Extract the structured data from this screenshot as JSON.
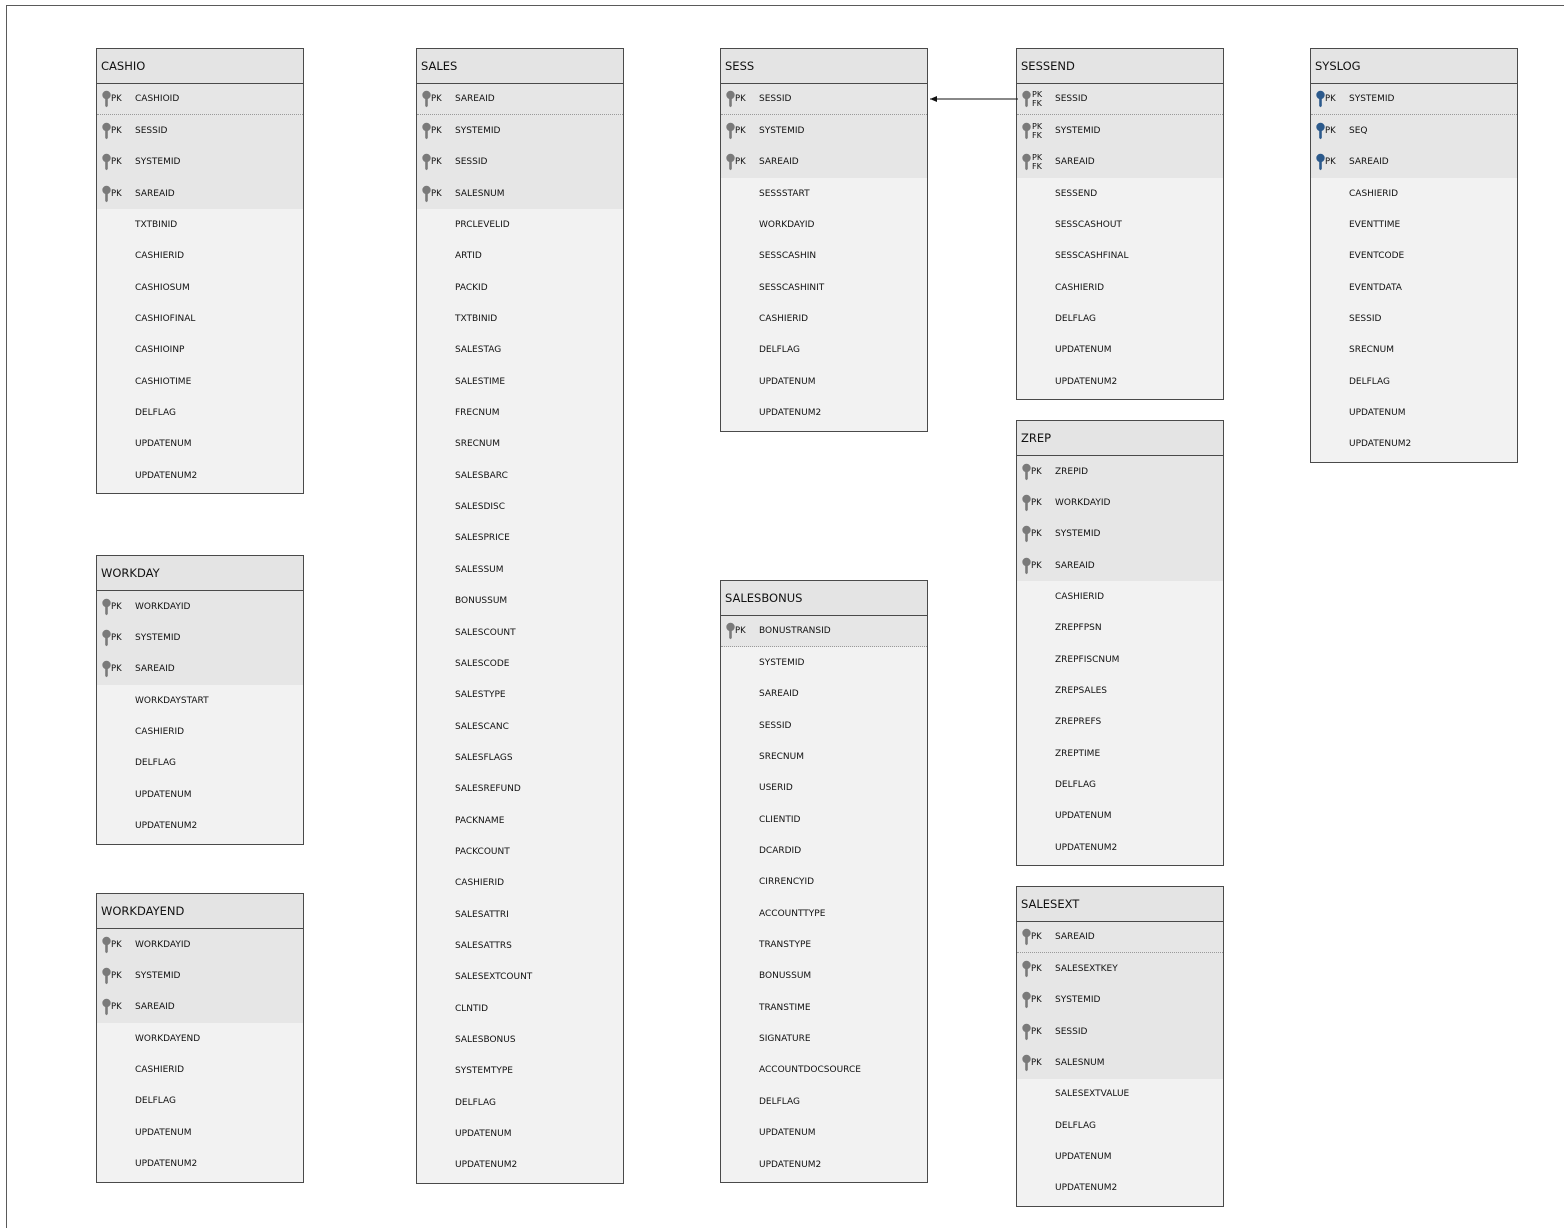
{
  "colors": {
    "key_grey": "#7a7a7a",
    "key_blue": "#2c5a8c",
    "header_bg": "#e4e4e4",
    "body_bg": "#f2f2f2"
  },
  "entities": {
    "cashio": {
      "name": "CASHIO",
      "keys": [
        {
          "label": "PK",
          "name": "CASHIOID"
        },
        {
          "label": "PK",
          "name": "SESSID"
        },
        {
          "label": "PK",
          "name": "SYSTEMID"
        },
        {
          "label": "PK",
          "name": "SAREAID"
        }
      ],
      "fields": [
        "TXTBINID",
        "CASHIERID",
        "CASHIOSUM",
        "CASHIOFINAL",
        "CASHIOINP",
        "CASHIOTIME",
        "DELFLAG",
        "UPDATENUM",
        "UPDATENUM2"
      ]
    },
    "workday": {
      "name": "WORKDAY",
      "keys": [
        {
          "label": "PK",
          "name": "WORKDAYID"
        },
        {
          "label": "PK",
          "name": "SYSTEMID"
        },
        {
          "label": "PK",
          "name": "SAREAID"
        }
      ],
      "fields": [
        "WORKDAYSTART",
        "CASHIERID",
        "DELFLAG",
        "UPDATENUM",
        "UPDATENUM2"
      ]
    },
    "workdayend": {
      "name": "WORKDAYEND",
      "keys": [
        {
          "label": "PK",
          "name": "WORKDAYID"
        },
        {
          "label": "PK",
          "name": "SYSTEMID"
        },
        {
          "label": "PK",
          "name": "SAREAID"
        }
      ],
      "fields": [
        "WORKDAYEND",
        "CASHIERID",
        "DELFLAG",
        "UPDATENUM",
        "UPDATENUM2"
      ]
    },
    "sales": {
      "name": "SALES",
      "keys": [
        {
          "label": "PK",
          "name": "SAREAID"
        },
        {
          "label": "PK",
          "name": "SYSTEMID"
        },
        {
          "label": "PK",
          "name": "SESSID"
        },
        {
          "label": "PK",
          "name": "SALESNUM"
        }
      ],
      "fields": [
        "PRCLEVELID",
        "ARTID",
        "PACKID",
        "TXTBINID",
        "SALESTAG",
        "SALESTIME",
        "FRECNUM",
        "SRECNUM",
        "SALESBARC",
        "SALESDISC",
        "SALESPRICE",
        "SALESSUM",
        "BONUSSUM",
        "SALESCOUNT",
        "SALESCODE",
        "SALESTYPE",
        "SALESCANC",
        "SALESFLAGS",
        "SALESREFUND",
        "PACKNAME",
        "PACKCOUNT",
        "CASHIERID",
        "SALESATTRI",
        "SALESATTRS",
        "SALESEXTCOUNT",
        "CLNTID",
        "SALESBONUS",
        "SYSTEMTYPE",
        "DELFLAG",
        "UPDATENUM",
        "UPDATENUM2"
      ]
    },
    "sess": {
      "name": "SESS",
      "keys": [
        {
          "label": "PK",
          "name": "SESSID"
        },
        {
          "label": "PK",
          "name": "SYSTEMID"
        },
        {
          "label": "PK",
          "name": "SAREAID"
        }
      ],
      "fields": [
        "SESSSTART",
        "WORKDAYID",
        "SESSCASHIN",
        "SESSCASHINIT",
        "CASHIERID",
        "DELFLAG",
        "UPDATENUM",
        "UPDATENUM2"
      ]
    },
    "salesbonus": {
      "name": "SALESBONUS",
      "keys": [
        {
          "label": "PK",
          "name": "BONUSTRANSID"
        }
      ],
      "fields": [
        "SYSTEMID",
        "SAREAID",
        "SESSID",
        "SRECNUM",
        "USERID",
        "CLIENTID",
        "DCARDID",
        "CIRRENCYID",
        "ACCOUNTTYPE",
        "TRANSTYPE",
        "BONUSSUM",
        "TRANSTIME",
        "SIGNATURE",
        "ACCOUNTDOCSOURCE",
        "DELFLAG",
        "UPDATENUM",
        "UPDATENUM2"
      ]
    },
    "sessend": {
      "name": "SESSEND",
      "keys": [
        {
          "label": "PK",
          "label2": "FK",
          "name": "SESSID"
        },
        {
          "label": "PK",
          "label2": "FK",
          "name": "SYSTEMID"
        },
        {
          "label": "PK",
          "label2": "FK",
          "name": "SAREAID"
        }
      ],
      "fields": [
        "SESSEND",
        "SESSCASHOUT",
        "SESSCASHFINAL",
        "CASHIERID",
        "DELFLAG",
        "UPDATENUM",
        "UPDATENUM2"
      ]
    },
    "zrep": {
      "name": "ZREP",
      "keys": [
        {
          "label": "PK",
          "name": "ZREPID"
        },
        {
          "label": "PK",
          "name": "WORKDAYID"
        },
        {
          "label": "PK",
          "name": "SYSTEMID"
        },
        {
          "label": "PK",
          "name": "SAREAID"
        }
      ],
      "fields": [
        "CASHIERID",
        "ZREPFPSN",
        "ZREPFISCNUM",
        "ZREPSALES",
        "ZREPREFS",
        "ZREPTIME",
        "DELFLAG",
        "UPDATENUM",
        "UPDATENUM2"
      ]
    },
    "salesext": {
      "name": "SALESEXT",
      "keys": [
        {
          "label": "PK",
          "name": "SAREAID"
        },
        {
          "label": "PK",
          "name": "SALESEXTKEY"
        },
        {
          "label": "PK",
          "name": "SYSTEMID"
        },
        {
          "label": "PK",
          "name": "SESSID"
        },
        {
          "label": "PK",
          "name": "SALESNUM"
        }
      ],
      "fields": [
        "SALESEXTVALUE",
        "DELFLAG",
        "UPDATENUM",
        "UPDATENUM2"
      ]
    },
    "syslog": {
      "name": "SYSLOG",
      "keys": [
        {
          "label": "PK",
          "name": "SYSTEMID"
        },
        {
          "label": "PK",
          "name": "SEQ"
        },
        {
          "label": "PK",
          "name": "SAREAID"
        }
      ],
      "fields": [
        "CASHIERID",
        "EVENTTIME",
        "EVENTCODE",
        "EVENTDATA",
        "SESSID",
        "SRECNUM",
        "DELFLAG",
        "UPDATENUM",
        "UPDATENUM2"
      ]
    }
  },
  "relations": [
    {
      "from": "SESSEND.SESSID",
      "to": "SESS.SESSID"
    }
  ]
}
